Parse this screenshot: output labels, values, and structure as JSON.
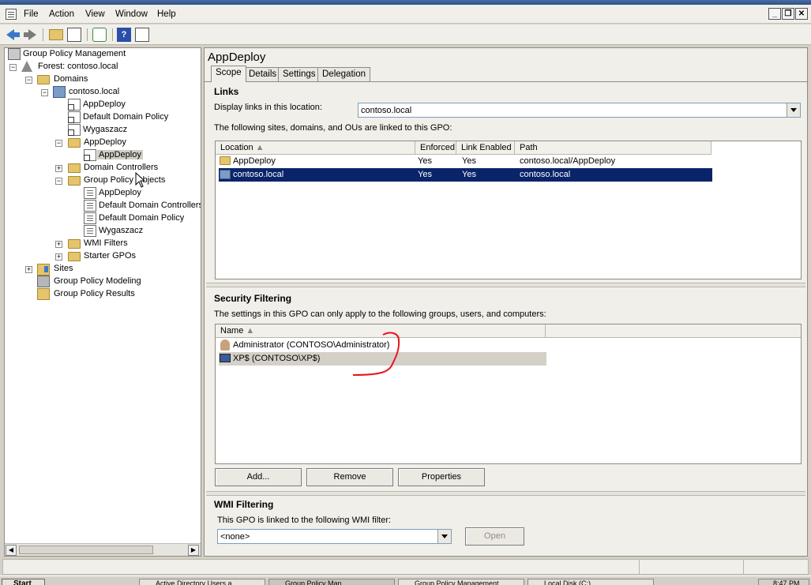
{
  "menu": {
    "items": [
      "File",
      "Action",
      "View",
      "Window",
      "Help"
    ]
  },
  "window_controls": {
    "minimize": "_",
    "restore": "❐",
    "close": "✕"
  },
  "toolbar": {
    "icons": [
      "back-icon",
      "forward-icon",
      "up-folder-icon",
      "show-hide-tree-icon",
      "refresh-icon",
      "help-icon",
      "properties-icon"
    ]
  },
  "tree": {
    "nodes": [
      {
        "label": "Group Policy Management",
        "icon": "gpm-icon"
      },
      {
        "label": "Forest: contoso.local",
        "icon": "forest-icon",
        "expander": "−"
      },
      {
        "label": "Domains",
        "icon": "folder-icon",
        "expander": "−"
      },
      {
        "label": "contoso.local",
        "icon": "domain-icon",
        "expander": "−"
      },
      {
        "label": "AppDeploy",
        "icon": "gpo-link-icon"
      },
      {
        "label": "Default Domain Policy",
        "icon": "gpo-link-icon"
      },
      {
        "label": "Wygaszacz",
        "icon": "gpo-link-icon"
      },
      {
        "label": "AppDeploy",
        "icon": "ou-folder-icon",
        "expander": "−"
      },
      {
        "label": "AppDeploy",
        "icon": "gpo-link-icon",
        "selected": true
      },
      {
        "label": "Domain Controllers",
        "icon": "ou-folder-icon",
        "expander": "+"
      },
      {
        "label": "Group Policy Objects",
        "icon": "folder-icon",
        "expander": "−"
      },
      {
        "label": "AppDeploy",
        "icon": "gpo-icon"
      },
      {
        "label": "Default Domain Controllers",
        "icon": "gpo-icon"
      },
      {
        "label": "Default Domain Policy",
        "icon": "gpo-icon"
      },
      {
        "label": "Wygaszacz",
        "icon": "gpo-icon"
      },
      {
        "label": "WMI Filters",
        "icon": "folder-icon",
        "expander": "+"
      },
      {
        "label": "Starter GPOs",
        "icon": "folder-icon",
        "expander": "+"
      },
      {
        "label": "Sites",
        "icon": "sites-icon",
        "expander": "+"
      },
      {
        "label": "Group Policy Modeling",
        "icon": "modeling-icon"
      },
      {
        "label": "Group Policy Results",
        "icon": "results-icon"
      }
    ]
  },
  "details": {
    "title": "AppDeploy",
    "tabs": [
      {
        "label": "Scope",
        "active": true
      },
      {
        "label": "Details"
      },
      {
        "label": "Settings"
      },
      {
        "label": "Delegation"
      }
    ],
    "links": {
      "heading": "Links",
      "display_label": "Display links in this location:",
      "location_value": "contoso.local",
      "description": "The following sites, domains, and OUs are linked to this GPO:",
      "columns": [
        "Location",
        "Enforced",
        "Link Enabled",
        "Path"
      ],
      "rows": [
        {
          "location": "AppDeploy",
          "enforced": "Yes",
          "link_enabled": "Yes",
          "path": "contoso.local/AppDeploy",
          "icon": "ou-folder-icon"
        },
        {
          "location": "contoso.local",
          "enforced": "Yes",
          "link_enabled": "Yes",
          "path": "contoso.local",
          "icon": "domain-icon",
          "selected": true
        }
      ]
    },
    "security": {
      "heading": "Security Filtering",
      "description": "The settings in this GPO can only apply to the following groups, users, and computers:",
      "columns": [
        "Name"
      ],
      "rows": [
        {
          "name": "Administrator (CONTOSO\\Administrator)",
          "icon": "user-icon"
        },
        {
          "name": "XP$ (CONTOSO\\XP$)",
          "icon": "computer-icon",
          "highlighted": true
        }
      ],
      "buttons": {
        "add": "Add...",
        "remove": "Remove",
        "properties": "Properties"
      }
    },
    "wmi": {
      "heading": "WMI Filtering",
      "description": "This GPO is linked to the following WMI filter:",
      "filter_value": "<none>",
      "open_button": "Open"
    }
  },
  "taskbar": {
    "start": "Start",
    "tasks": [
      "Active Directory Users a...",
      "Group Policy Man...",
      "Group Policy Management ...",
      "Local Disk (C:)"
    ],
    "clock": "8:47 PM"
  },
  "colors": {
    "selection": "#0a246a",
    "annotation": "#e8151b"
  }
}
